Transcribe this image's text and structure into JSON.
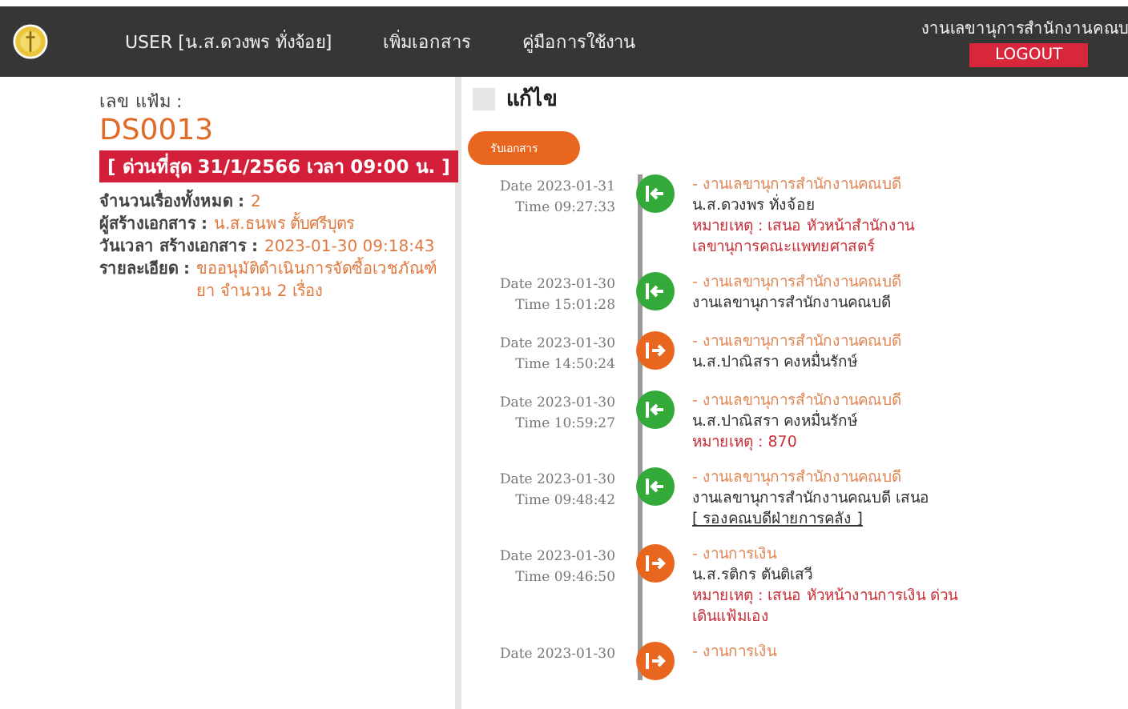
{
  "header": {
    "user": "USER [น.ส.ดวงพร ทั่งจ้อย]",
    "nav": [
      "เพิ่มเอกสาร",
      "คู่มือการใช้งาน"
    ],
    "department": "งานเลขานุการสำนักงานคณบ",
    "logout": "LOGOUT"
  },
  "document": {
    "number_label": "เลข แฟ้ม :",
    "number": "DS0013",
    "urgency": "[ ด่วนที่สุด 31/1/2566 เวลา 09:00 น. ]",
    "fields": [
      {
        "label": "จำนวนเรื่องทั้งหมด :",
        "value": "2"
      },
      {
        "label": "ผู้สร้างเอกสาร :",
        "value": "น.ส.ธนพร ตั้บศรีบุตร"
      },
      {
        "label": "วันเวลา สร้างเอกสาร :",
        "value": "2023-01-30 09:18:43"
      },
      {
        "label": "รายละเอียด :",
        "value": "ขออนุมัติดำเนินการจัดซื้อเวชภัณฑ์ยา จำนวน 2 เรื่อง"
      }
    ]
  },
  "history": {
    "title": "แก้ไข",
    "button": "รับเอกสาร",
    "entries": [
      {
        "kind": "in",
        "date": "Date 2023-01-31",
        "time": "Time 09:27:33",
        "department": "- งานเลขานุการสำนักงานคณบดี",
        "person": "น.ส.ดวงพร ทั่งจ้อย",
        "note": "หมายเหตุ : เสนอ หัวหน้าสำนักงานเลขานุการคณะแพทยศาสตร์"
      },
      {
        "kind": "in",
        "date": "Date 2023-01-30",
        "time": "Time 15:01:28",
        "department": "- งานเลขานุการสำนักงานคณบดี",
        "person": "งานเลขานุการสำนักงานคณบดี"
      },
      {
        "kind": "out",
        "date": "Date 2023-01-30",
        "time": "Time 14:50:24",
        "department": "- งานเลขานุการสำนักงานคณบดี",
        "person": "น.ส.ปาณิสรา คงหมื่นรักษ์"
      },
      {
        "kind": "in",
        "date": "Date 2023-01-30",
        "time": "Time 10:59:27",
        "department": "- งานเลขานุการสำนักงานคณบดี",
        "person": "น.ส.ปาณิสรา คงหมื่นรักษ์",
        "note": "หมายเหตุ : 870"
      },
      {
        "kind": "in",
        "date": "Date 2023-01-30",
        "time": "Time 09:48:42",
        "department": "- งานเลขานุการสำนักงานคณบดี",
        "person": "งานเลขานุการสำนักงานคณบดี เสนอ",
        "link": "[ รองคณบดีฝ่ายการคลัง ]"
      },
      {
        "kind": "out",
        "date": "Date 2023-01-30",
        "time": "Time 09:46:50",
        "department": "- งานการเงิน",
        "person": "น.ส.รติกร ตันติเสวี",
        "note": "หมายเหตุ : เสนอ หัวหน้างานการเงิน ด่วน เดินแฟ้มเอง"
      },
      {
        "kind": "out",
        "date": "Date 2023-01-30",
        "department": "- งานการเงิน"
      }
    ]
  }
}
